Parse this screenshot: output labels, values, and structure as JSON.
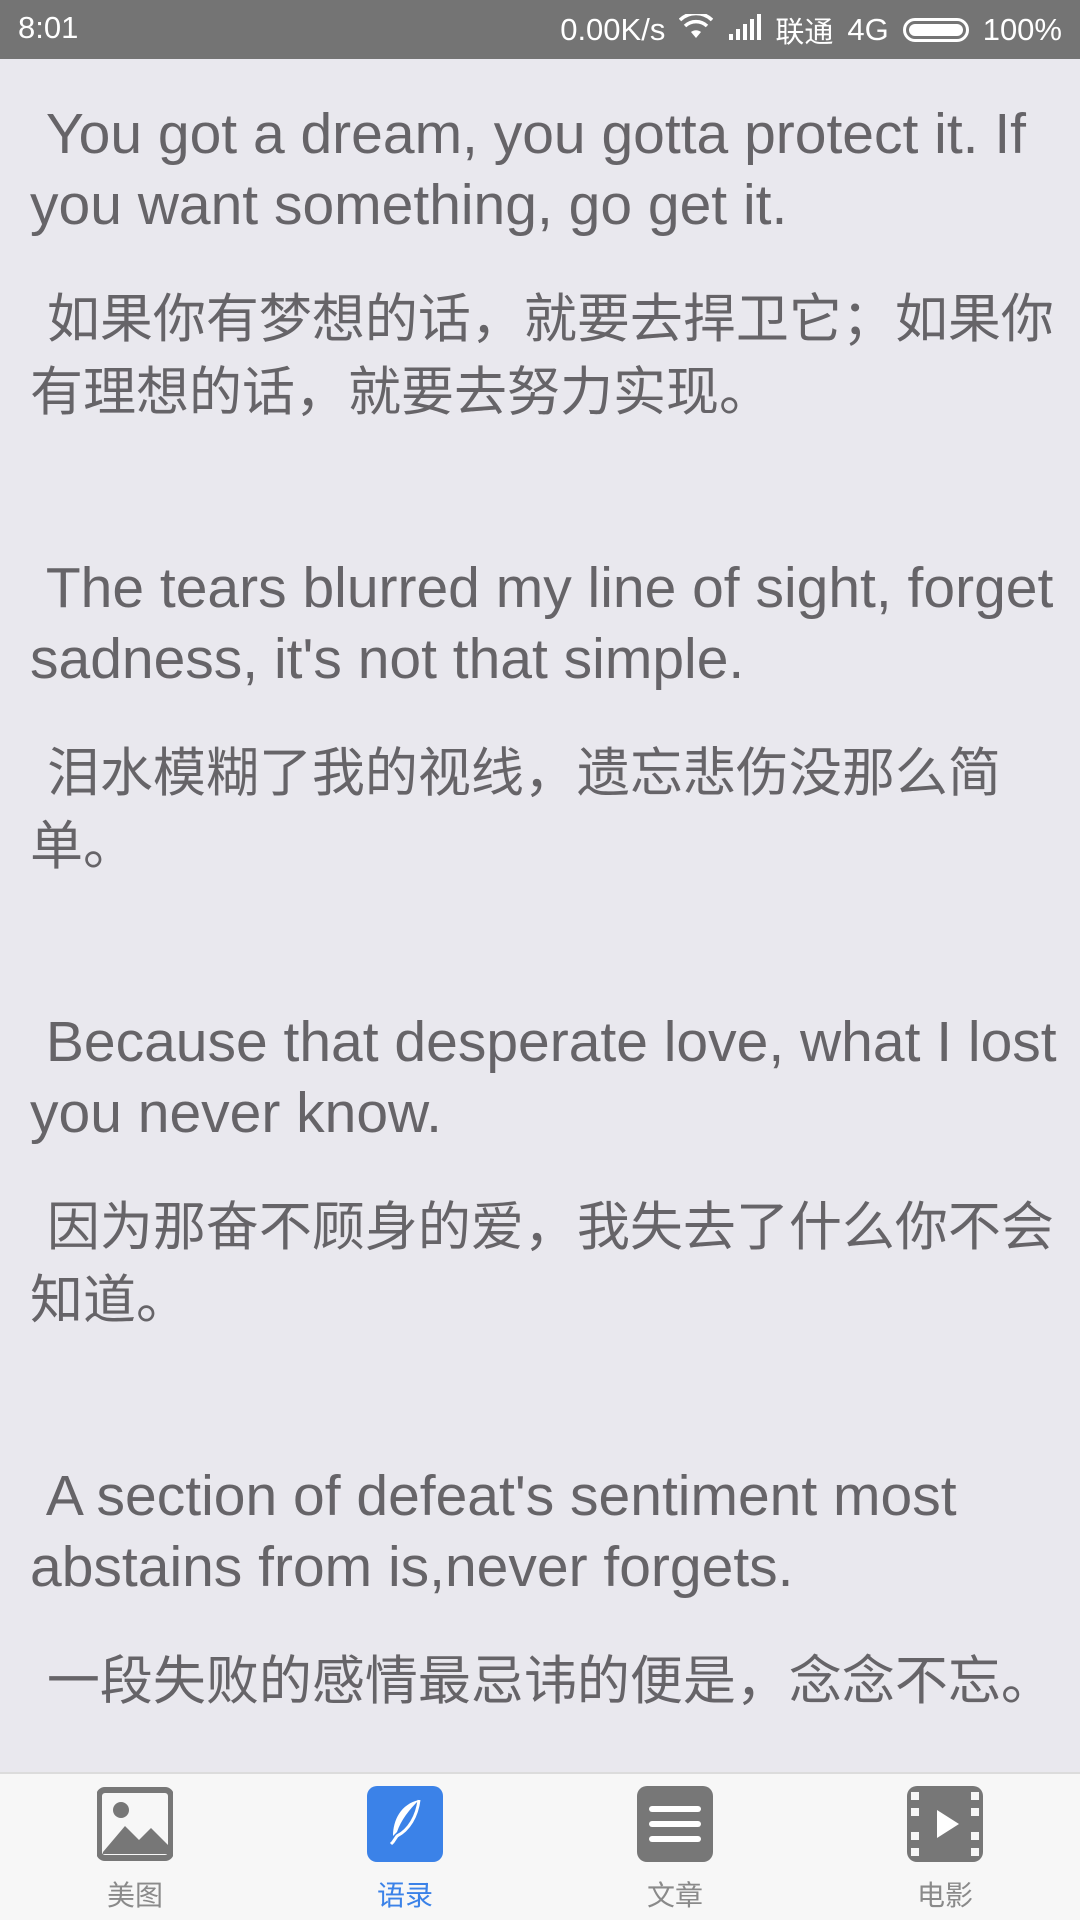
{
  "status_bar": {
    "time": "8:01",
    "speed": "0.00K/s",
    "carrier": "联通",
    "network": "4G",
    "battery": "100%"
  },
  "quotes": [
    {
      "en": " You got a dream, you gotta protect it. If you want something, go get it.",
      "zh": " 如果你有梦想的话，就要去捍卫它；如果你有理想的话，就要去努力实现。"
    },
    {
      "en": " The tears blurred my line of sight, forget sadness, it's not that simple.",
      "zh": " 泪水模糊了我的视线，遗忘悲伤没那么简单。"
    },
    {
      "en": " Because that desperate love, what I lost you never know.",
      "zh": " 因为那奋不顾身的爱，我失去了什么你不会知道。"
    },
    {
      "en": " A section of defeat's sentiment most abstains from is,never forgets.",
      "zh": " 一段失败的感情最忌讳的便是，念念不忘。"
    }
  ],
  "bottom_nav": {
    "active_color": "#3b82e8",
    "items": [
      {
        "label": "美图",
        "icon": "picture-icon"
      },
      {
        "label": "语录",
        "icon": "feather-icon"
      },
      {
        "label": "文章",
        "icon": "article-icon"
      },
      {
        "label": "电影",
        "icon": "film-icon"
      }
    ]
  }
}
